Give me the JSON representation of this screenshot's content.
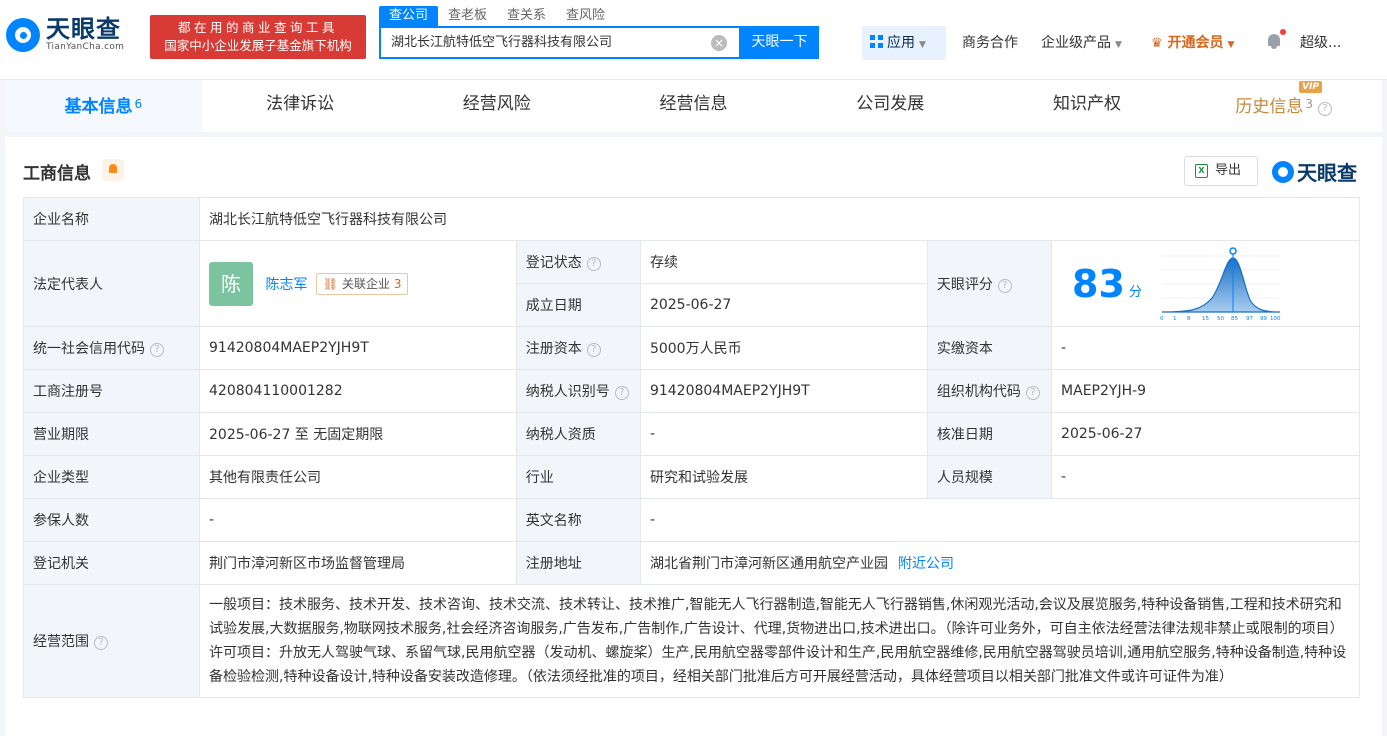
{
  "header": {
    "logo_cn": "天眼查",
    "logo_en": "TianYanCha.com",
    "slogan1": "都在用的商业查询工具",
    "slogan2": "国家中小企业发展子基金旗下机构",
    "search_tabs": [
      "查公司",
      "查老板",
      "查关系",
      "查风险"
    ],
    "search_value": "湖北长江航特低空飞行器科技有限公司",
    "search_button": "天眼一下",
    "apps_label": "应用",
    "nav": [
      "商务合作",
      "企业级产品"
    ],
    "vip_label": "开通会员",
    "user_label": "超级..."
  },
  "tabs": [
    {
      "label": "基本信息",
      "count": "6"
    },
    {
      "label": "法律诉讼"
    },
    {
      "label": "经营风险"
    },
    {
      "label": "经营信息"
    },
    {
      "label": "公司发展"
    },
    {
      "label": "知识产权"
    },
    {
      "label": "历史信息",
      "count": "3",
      "badge": "VIP"
    }
  ],
  "section": {
    "title": "工商信息",
    "export_label": "导出",
    "brand": "天眼查"
  },
  "info": {
    "company_name_label": "企业名称",
    "company_name": "湖北长江航特低空飞行器科技有限公司",
    "legal_rep_label": "法定代表人",
    "avatar_char": "陈",
    "legal_rep": "陈志军",
    "related_label": "关联企业",
    "related_count": "3",
    "reg_status_label": "登记状态",
    "reg_status": "存续",
    "found_date_label": "成立日期",
    "found_date": "2025-06-27",
    "score_label": "天眼评分",
    "score": "83",
    "score_unit": "分",
    "score_axis": [
      "0",
      "1",
      "8",
      "15",
      "50",
      "85",
      "97",
      "99",
      "100"
    ],
    "credit_code_label": "统一社会信用代码",
    "credit_code": "91420804MAEP2YJH9T",
    "reg_capital_label": "注册资本",
    "reg_capital": "5000万人民币",
    "paid_capital_label": "实缴资本",
    "paid_capital": "-",
    "reg_no_label": "工商注册号",
    "reg_no": "420804110001282",
    "taxpayer_id_label": "纳税人识别号",
    "taxpayer_id": "91420804MAEP2YJH9T",
    "org_code_label": "组织机构代码",
    "org_code": "MAEP2YJH-9",
    "term_label": "营业期限",
    "term": "2025-06-27 至 无固定期限",
    "taxpayer_qual_label": "纳税人资质",
    "taxpayer_qual": "-",
    "approve_date_label": "核准日期",
    "approve_date": "2025-06-27",
    "type_label": "企业类型",
    "type": "其他有限责任公司",
    "industry_label": "行业",
    "industry": "研究和试验发展",
    "staff_label": "人员规模",
    "staff": "-",
    "insured_label": "参保人数",
    "insured": "-",
    "en_name_label": "英文名称",
    "en_name": "-",
    "authority_label": "登记机关",
    "authority": "荆门市漳河新区市场监督管理局",
    "address_label": "注册地址",
    "address": "湖北省荆门市漳河新区通用航空产业园",
    "nearby_label": "附近公司",
    "scope_label": "经营范围",
    "scope": "一般项目：技术服务、技术开发、技术咨询、技术交流、技术转让、技术推广,智能无人飞行器制造,智能无人飞行器销售,休闲观光活动,会议及展览服务,特种设备销售,工程和技术研究和试验发展,大数据服务,物联网技术服务,社会经济咨询服务,广告发布,广告制作,广告设计、代理,货物进出口,技术进出口。（除许可业务外，可自主依法经营法律法规非禁止或限制的项目）许可项目：升放无人驾驶气球、系留气球,民用航空器（发动机、螺旋桨）生产,民用航空器零部件设计和生产,民用航空器维修,民用航空器驾驶员培训,通用航空服务,特种设备制造,特种设备检验检测,特种设备设计,特种设备安装改造修理。（依法须经批准的项目，经相关部门批准后方可开展经营活动，具体经营项目以相关部门批准文件或许可证件为准）"
  }
}
